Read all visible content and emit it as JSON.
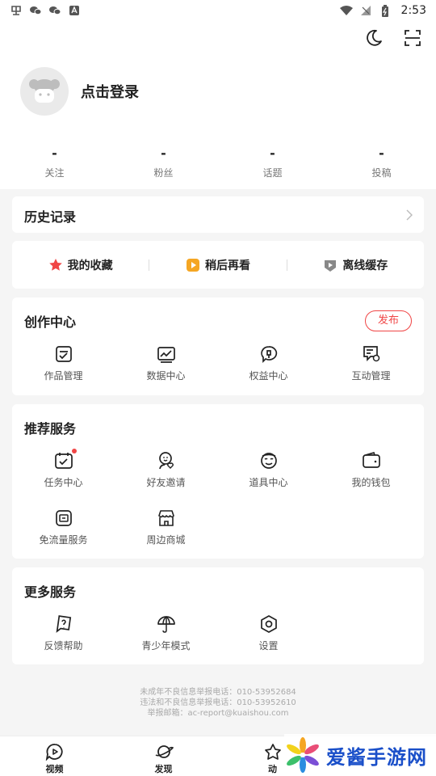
{
  "status_bar": {
    "time": "2:53",
    "left_icons": [
      "app-notification-icon",
      "wechat-icon",
      "wechat-icon",
      "app-notification-icon"
    ],
    "right_icons": [
      "wifi-icon",
      "signal-icon",
      "battery-icon"
    ]
  },
  "header": {
    "icons": [
      "moon-icon",
      "scan-icon"
    ],
    "login_text": "点击登录",
    "stats": [
      {
        "value": "-",
        "label": "关注"
      },
      {
        "value": "-",
        "label": "粉丝"
      },
      {
        "value": "-",
        "label": "话题"
      },
      {
        "value": "-",
        "label": "投稿"
      }
    ]
  },
  "history": {
    "title": "历史记录"
  },
  "quick": [
    {
      "label": "我的收藏",
      "icon": "star-icon",
      "color": "#f04646"
    },
    {
      "label": "稍后再看",
      "icon": "play-later-icon",
      "color": "#f5a623"
    },
    {
      "label": "离线缓存",
      "icon": "download-icon",
      "color": "#888888"
    }
  ],
  "create_center": {
    "title": "创作中心",
    "publish_label": "发布",
    "items": [
      {
        "label": "作品管理",
        "icon": "works-icon"
      },
      {
        "label": "数据中心",
        "icon": "chart-icon"
      },
      {
        "label": "权益中心",
        "icon": "benefits-icon"
      },
      {
        "label": "互动管理",
        "icon": "interaction-icon"
      }
    ]
  },
  "recommend": {
    "title": "推荐服务",
    "items": [
      {
        "label": "任务中心",
        "icon": "calendar-icon"
      },
      {
        "label": "好友邀请",
        "icon": "invite-friend-icon"
      },
      {
        "label": "道具中心",
        "icon": "mask-icon"
      },
      {
        "label": "我的钱包",
        "icon": "wallet-icon"
      },
      {
        "label": "免流量服务",
        "icon": "sim-icon"
      },
      {
        "label": "周边商城",
        "icon": "shop-icon"
      }
    ]
  },
  "more": {
    "title": "更多服务",
    "items": [
      {
        "label": "反馈帮助",
        "icon": "feedback-icon"
      },
      {
        "label": "青少年模式",
        "icon": "umbrella-icon"
      },
      {
        "label": "设置",
        "icon": "settings-icon"
      }
    ]
  },
  "footer": {
    "line1": "未成年不良信息举报电话：010-53952684",
    "line2": "违法和不良信息举报电话：010-53952610",
    "line3": "举报邮箱：ac-report@kuaishou.com"
  },
  "bottom_nav": [
    {
      "label": "视频",
      "icon": "video-icon"
    },
    {
      "label": "发现",
      "icon": "planet-icon"
    },
    {
      "label": "动",
      "icon": "dynamic-icon"
    }
  ],
  "watermark": {
    "text": "爱酱手游网"
  },
  "colors": {
    "accent": "#f04646",
    "watermark_blue": "#1a4fc9"
  }
}
